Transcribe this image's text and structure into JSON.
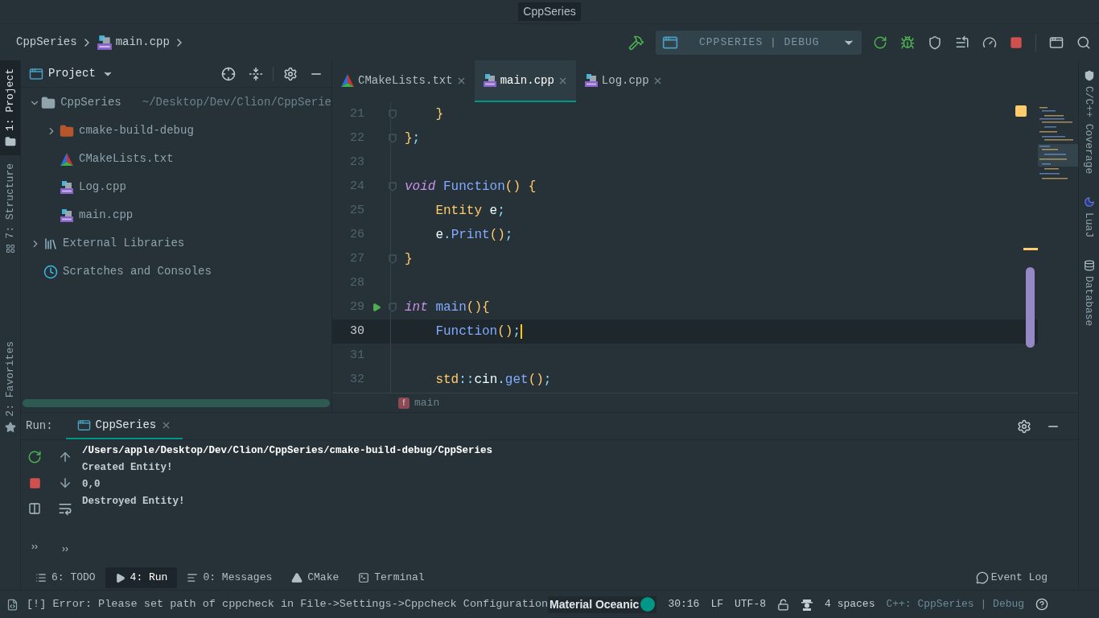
{
  "window": {
    "title": "CppSeries"
  },
  "breadcrumbs": [
    {
      "label": "CppSeries",
      "kind": "none"
    },
    {
      "label": "main.cpp",
      "kind": "cpp"
    }
  ],
  "run_config": {
    "label": "CPPSERIES | DEBUG"
  },
  "left_strip": [
    {
      "label": "1: Project",
      "selected": true,
      "kind": "folder"
    },
    {
      "label": "7: Structure",
      "selected": false,
      "kind": "structure"
    }
  ],
  "left_strip_bottom": [
    {
      "label": "2: Favorites",
      "selected": false,
      "kind": "star"
    }
  ],
  "right_strip": [
    {
      "label": "C/C++ Coverage",
      "kind": "shield"
    },
    {
      "label": "LuaJ",
      "kind": "moon"
    },
    {
      "label": "Database",
      "kind": "database"
    }
  ],
  "project": {
    "title": "Project",
    "tree": [
      {
        "label": "CppSeries",
        "path": "~/Desktop/Dev/Clion/CppSerie",
        "kind": "folder",
        "expanded": true,
        "children": [
          {
            "label": "cmake-build-debug",
            "kind": "build-folder",
            "expanded": false
          },
          {
            "label": "CMakeLists.txt",
            "kind": "cmake"
          },
          {
            "label": "Log.cpp",
            "kind": "cpp"
          },
          {
            "label": "main.cpp",
            "kind": "cpp"
          }
        ]
      },
      {
        "label": "External Libraries",
        "kind": "library",
        "expanded": false
      },
      {
        "label": "Scratches and Consoles",
        "kind": "scratch"
      }
    ]
  },
  "editor": {
    "tabs": [
      {
        "label": "CMakeLists.txt",
        "kind": "cmake",
        "selected": false
      },
      {
        "label": "main.cpp",
        "kind": "cpp",
        "selected": true
      },
      {
        "label": "Log.cpp",
        "kind": "cpp",
        "selected": false
      }
    ],
    "lines": [
      {
        "number": "21",
        "current": false,
        "run_marker": false,
        "fold": true,
        "tokens": [
          {
            "text": "    }",
            "kind": "brace"
          }
        ]
      },
      {
        "number": "22",
        "current": false,
        "run_marker": false,
        "fold": true,
        "tokens": [
          {
            "text": "}",
            "kind": "brace"
          },
          {
            "text": ";",
            "kind": "punct"
          }
        ]
      },
      {
        "number": "23",
        "current": false,
        "run_marker": false,
        "fold": false
      },
      {
        "number": "24",
        "current": false,
        "run_marker": false,
        "fold": true,
        "tokens": [
          {
            "text": "void",
            "kind": "keyword"
          },
          {
            "text": " Function",
            "kind": "function"
          },
          {
            "text": "() {",
            "kind": "brace"
          }
        ]
      },
      {
        "number": "25",
        "current": false,
        "run_marker": false,
        "fold": false,
        "tokens": [
          {
            "text": "    Entity",
            "kind": "type"
          },
          {
            "text": " e",
            "kind": "plain"
          },
          {
            "text": ";",
            "kind": "punct"
          }
        ]
      },
      {
        "number": "26",
        "current": false,
        "run_marker": false,
        "fold": false,
        "tokens": [
          {
            "text": "    e",
            "kind": "plain"
          },
          {
            "text": ".",
            "kind": "punct"
          },
          {
            "text": "Print",
            "kind": "function"
          },
          {
            "text": "()",
            "kind": "brace"
          },
          {
            "text": ";",
            "kind": "punct"
          }
        ]
      },
      {
        "number": "27",
        "current": false,
        "run_marker": false,
        "fold": true,
        "tokens": [
          {
            "text": "}",
            "kind": "brace"
          }
        ]
      },
      {
        "number": "28",
        "current": false,
        "run_marker": false,
        "fold": false
      },
      {
        "number": "29",
        "current": false,
        "run_marker": true,
        "fold": true,
        "tokens": [
          {
            "text": "int",
            "kind": "keyword"
          },
          {
            "text": " main",
            "kind": "function"
          },
          {
            "text": "(){",
            "kind": "brace"
          }
        ]
      },
      {
        "number": "30",
        "current": true,
        "run_marker": false,
        "fold": false,
        "tokens": [
          {
            "text": "    Function",
            "kind": "function"
          },
          {
            "text": "()",
            "kind": "brace"
          },
          {
            "text": ";",
            "kind": "punct"
          }
        ]
      },
      {
        "number": "31",
        "current": false,
        "run_marker": false,
        "fold": false
      },
      {
        "number": "32",
        "current": false,
        "run_marker": false,
        "fold": false,
        "tokens": [
          {
            "text": "    std",
            "kind": "type"
          },
          {
            "text": "::",
            "kind": "punct"
          },
          {
            "text": "cin",
            "kind": "plain"
          },
          {
            "text": ".",
            "kind": "punct"
          },
          {
            "text": "get",
            "kind": "function"
          },
          {
            "text": "()",
            "kind": "brace"
          },
          {
            "text": ";",
            "kind": "punct"
          }
        ]
      }
    ],
    "scope": {
      "badge": "f",
      "label": "main"
    }
  },
  "run": {
    "title": "Run:",
    "tab": {
      "label": "CppSeries",
      "selected": true
    },
    "output": [
      "/Users/apple/Desktop/Dev/Clion/CppSeries/cmake-build-debug/CppSeries",
      "Created Entity!",
      "0,0",
      "Destroyed Entity!"
    ],
    "more": [
      "››",
      "››"
    ]
  },
  "tool_tabs": [
    {
      "label": "6: TODO",
      "kind": "list",
      "selected": false
    },
    {
      "label": "4: Run",
      "kind": "play",
      "selected": true
    },
    {
      "label": "0: Messages",
      "kind": "messages",
      "selected": false
    },
    {
      "label": "CMake",
      "kind": "triangle",
      "selected": false
    },
    {
      "label": "Terminal",
      "kind": "terminal",
      "selected": false
    }
  ],
  "event_log": "Event Log",
  "status_bar": {
    "message": "[!] Error: Please set path of cppcheck in File->Settings->Cppcheck Configuration",
    "theme": "Material Oceanic",
    "position": "30:16",
    "line_sep": "LF",
    "encoding": "UTF-8",
    "indent": "4 spaces",
    "context": "C++: CppSeries | Debug"
  }
}
